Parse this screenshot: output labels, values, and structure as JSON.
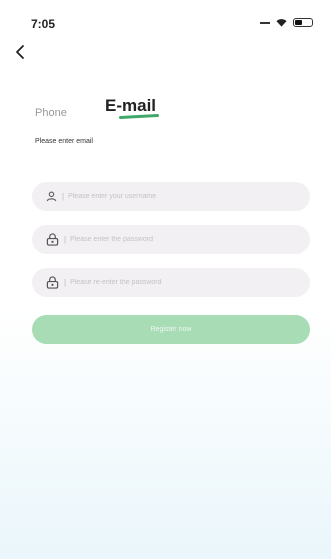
{
  "status_bar": {
    "time": "7:05"
  },
  "tabs": {
    "phone_label": "Phone",
    "email_label": "E-mail"
  },
  "form": {
    "hint": "Please enter email",
    "username_placeholder": "Please enter your username",
    "password_placeholder": "Please enter the password",
    "repassword_placeholder": "Please re-enter the password",
    "separator": "|",
    "submit_label": "Register now"
  },
  "icons": {
    "back": "chevron-left-icon",
    "user": "user-icon",
    "lock": "lock-icon",
    "wifi": "wifi-icon",
    "battery": "battery-icon"
  },
  "colors": {
    "accent": "#3fa86a",
    "button": "#a7dcb5",
    "field_bg": "#f2f0f2"
  }
}
